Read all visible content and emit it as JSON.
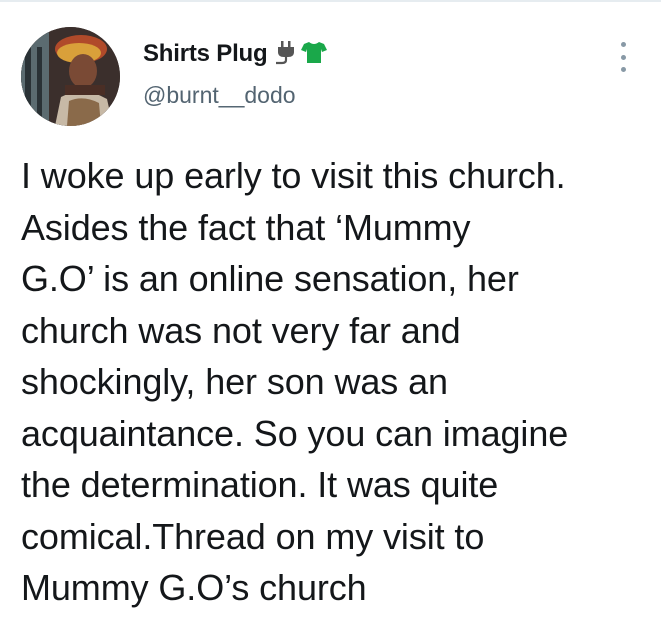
{
  "user": {
    "display_name": "Shirts Plug",
    "handle": "@burnt__dodo",
    "emojis": [
      "electric-plug-icon",
      "t-shirt-icon"
    ]
  },
  "tweet": {
    "text": "I woke up early to visit this church.\nAsides the fact that ‘Mummy\nG.O’ is an online sensation, her\nchurch was not very far and\nshockingly, her son was an\nacquaintance. So you can imagine\nthe determination. It was quite\ncomical.Thread on my visit to\nMummy G.O’s church"
  },
  "colors": {
    "text": "#14171a",
    "secondary": "#536471",
    "tshirt": "#1aa84a",
    "plug": "#555555"
  }
}
